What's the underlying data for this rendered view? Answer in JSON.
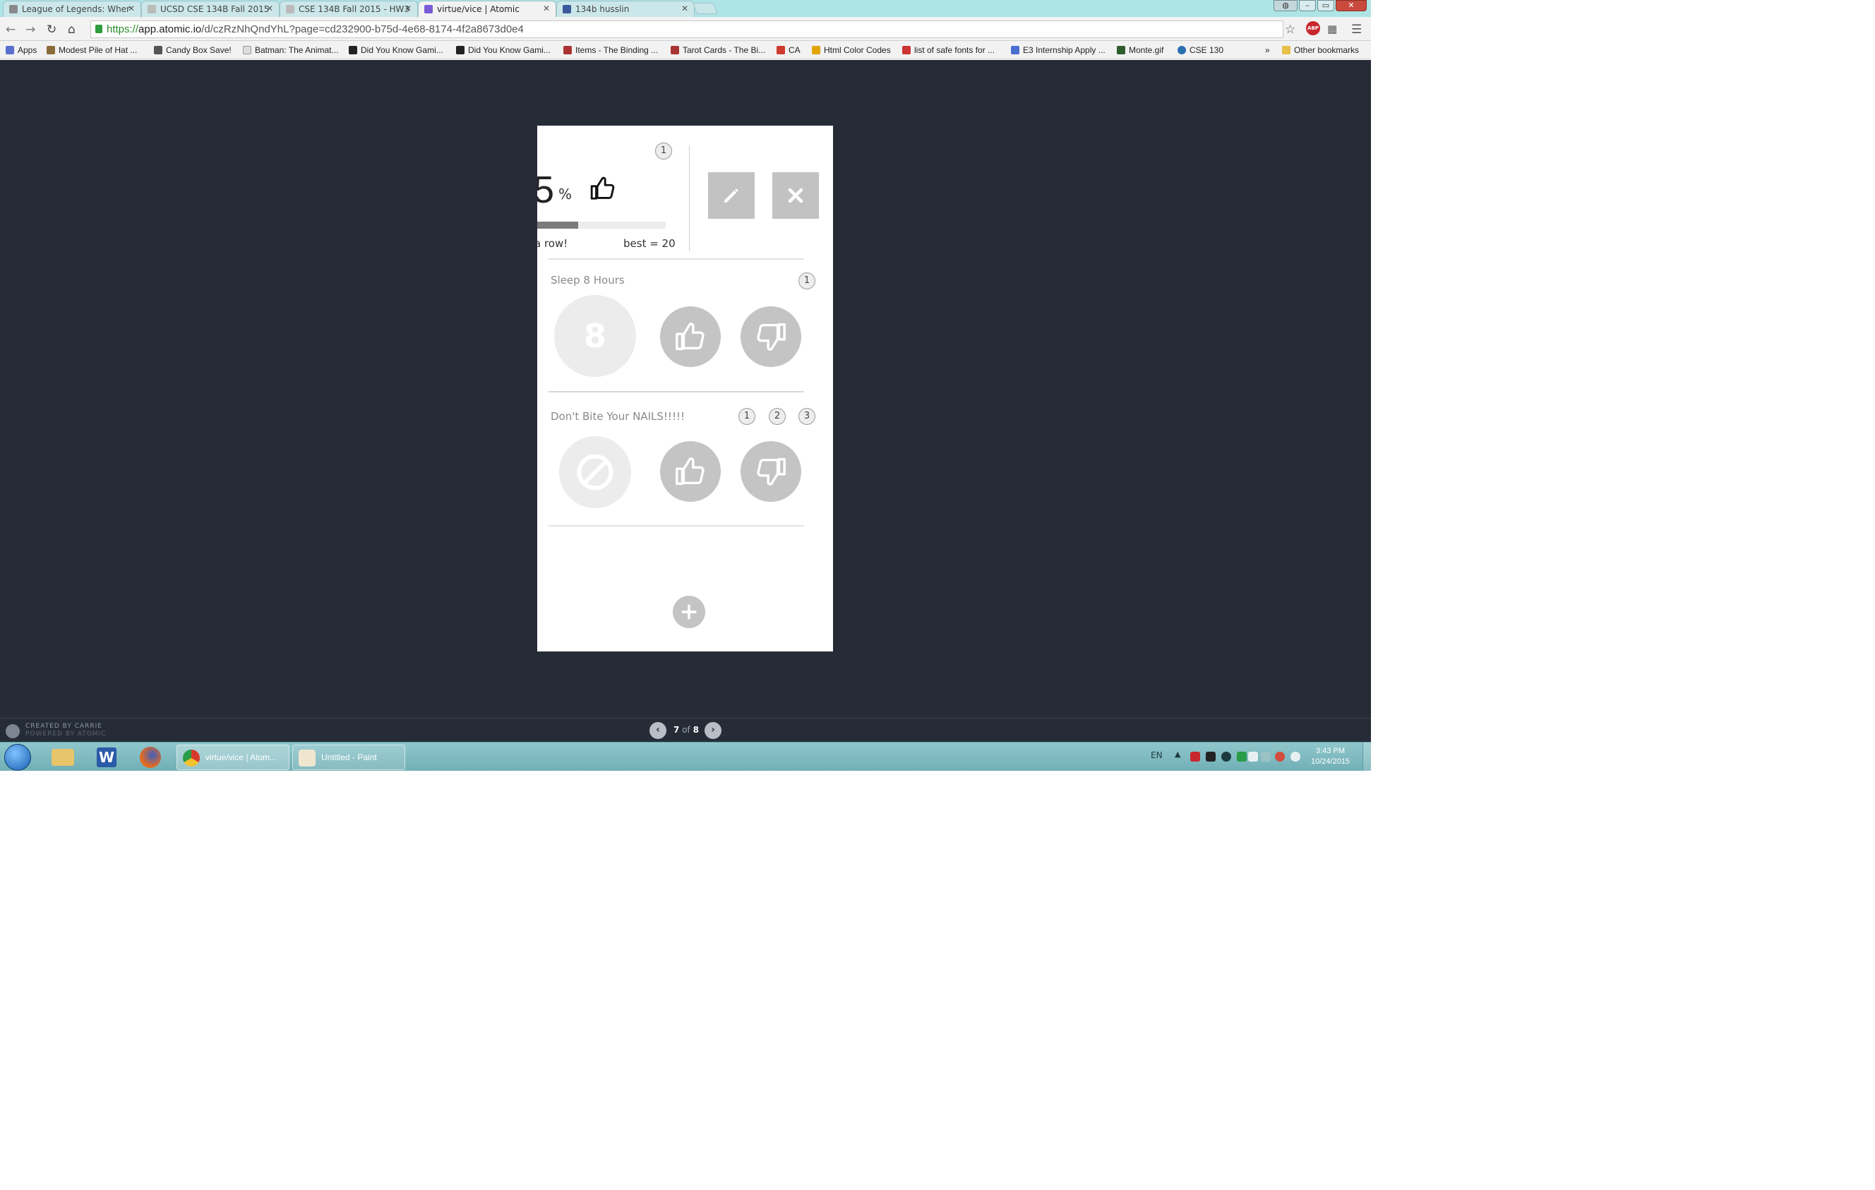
{
  "browser": {
    "tabs": [
      {
        "title": "League of Legends: Wher",
        "active": false
      },
      {
        "title": "UCSD CSE 134B Fall 2015",
        "active": false
      },
      {
        "title": "CSE 134B Fall 2015 - HW3",
        "active": false
      },
      {
        "title": "virtue/vice | Atomic",
        "active": true
      },
      {
        "title": "134b husslin",
        "active": false
      }
    ],
    "url_scheme": "https://",
    "url_host": "app.atomic.io",
    "url_path": "/d/czRzNhQndYhL?page=cd232900-b75d-4e68-8174-4f2a8673d0e4",
    "bookmarks": [
      "Apps",
      "Modest Pile of Hat ...",
      "Candy Box Save!",
      "Batman: The Animat...",
      "Did You Know Gami...",
      "Did You Know Gami...",
      "Items - The Binding ...",
      "Tarot Cards - The Bi...",
      "CA",
      "Html Color Codes",
      "list of safe fonts for ...",
      "E3 Internship Apply ...",
      "Monte.gif",
      "CSE 130"
    ],
    "bookmarks_overflow": "»",
    "other_bookmarks": "Other bookmarks",
    "abp_label": "ABP"
  },
  "app": {
    "summary": {
      "badge": "1",
      "percent_digit": "5",
      "percent_sign": "%",
      "progress": 0.32,
      "streak_text": "a row!",
      "best_text": "best = 20"
    },
    "habits": [
      {
        "title": "Sleep 8 Hours",
        "badges": [
          "1"
        ],
        "counter": "8"
      },
      {
        "title": "Don't Bite Your NAILS!!!!!",
        "badges": [
          "1",
          "2",
          "3"
        ]
      }
    ],
    "footer": {
      "credit_line1": "CREATED BY CARRIE",
      "credit_line2": "POWERED BY ATOMIC",
      "page_current": "7",
      "page_of": "of",
      "page_total": "8"
    }
  },
  "taskbar": {
    "tasks": [
      {
        "title": "virtue/vice | Atom..."
      },
      {
        "title": "Untitled - Paint"
      }
    ],
    "lang": "EN",
    "time": "3:43 PM",
    "date": "10/24/2015"
  },
  "colors": {
    "page_bg": "#262c36",
    "button_gray": "#c2c2c2",
    "url_green": "#2a8a2a"
  }
}
